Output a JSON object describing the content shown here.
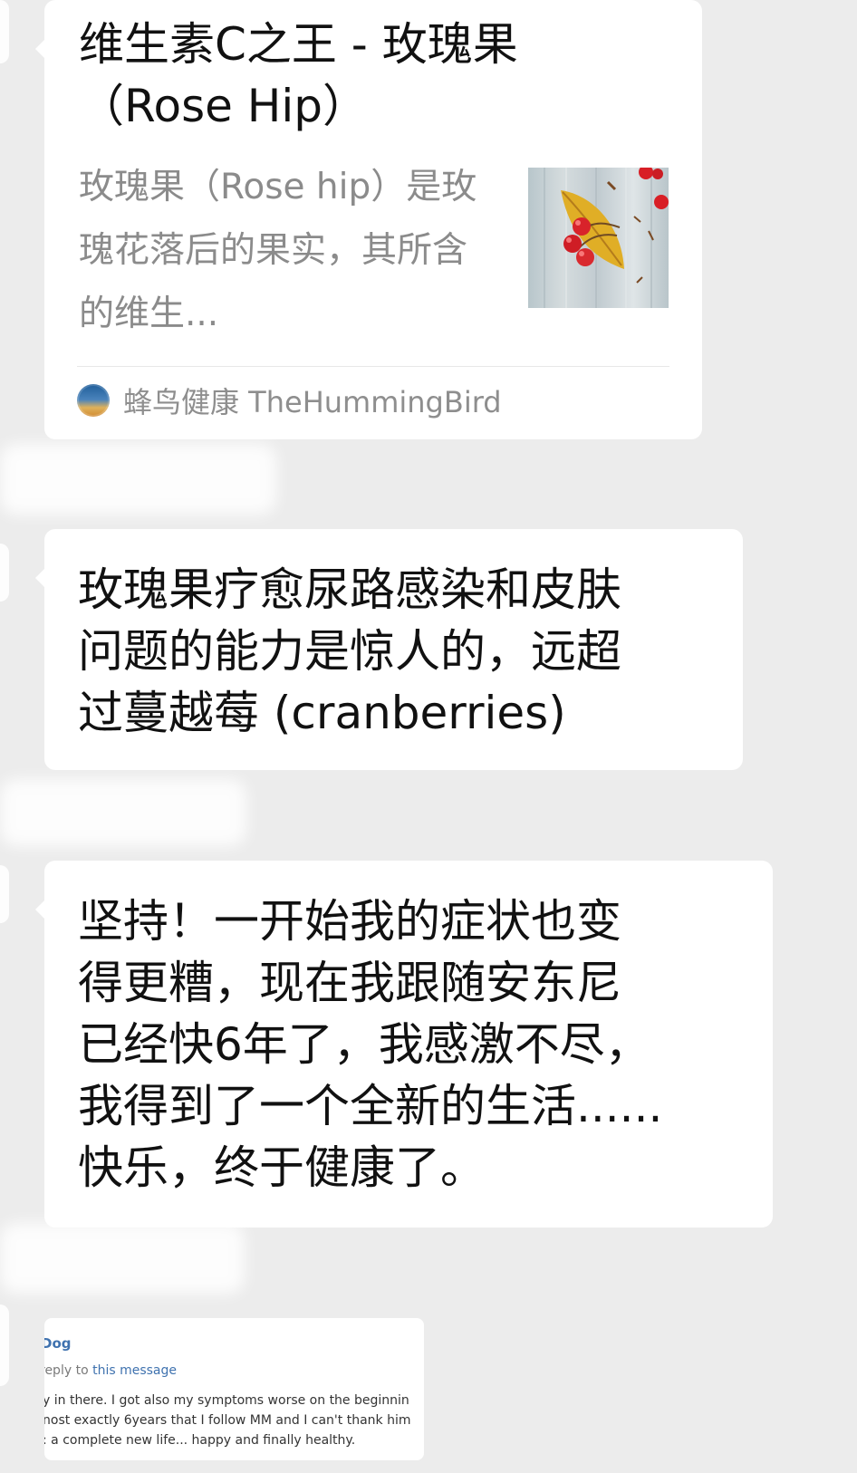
{
  "article_card": {
    "title": "维生素C之王 - 玫瑰果（Rose Hip）",
    "summary": "玫瑰果（Rose hip）是玫瑰花落后的果实，其所含的维生...",
    "source_name": "蜂鸟健康 TheHummingBird",
    "thumbnail_icon": "rose-hip-berries-on-leaf-icon"
  },
  "messages": [
    {
      "text": "玫瑰果疗愈尿路感染和皮肤\n问题的能力是惊人的，远超\n过蔓越莓 (cranberries)"
    },
    {
      "text": "坚持！一开始我的症状也变\n得更糟，现在我跟随安东尼\n已经快6年了，我感激不尽，\n我得到了一个全新的生活......\n快乐，终于健康了。"
    }
  ],
  "reply_screenshot": {
    "sender": "Dog",
    "context_prefix": "reply to ",
    "context_link": "this message",
    "lines": [
      "y in there. I got also my symptoms worse on the beginnin",
      "nost exactly 6years that I follow MM and I can't thank him",
      ": a complete new life... happy and finally healthy."
    ]
  },
  "colors": {
    "page_background": "#ececec",
    "bubble_background": "#ffffff",
    "title_text": "#111111",
    "secondary_text": "#8b8b8b",
    "link_blue": "#3f72af"
  }
}
